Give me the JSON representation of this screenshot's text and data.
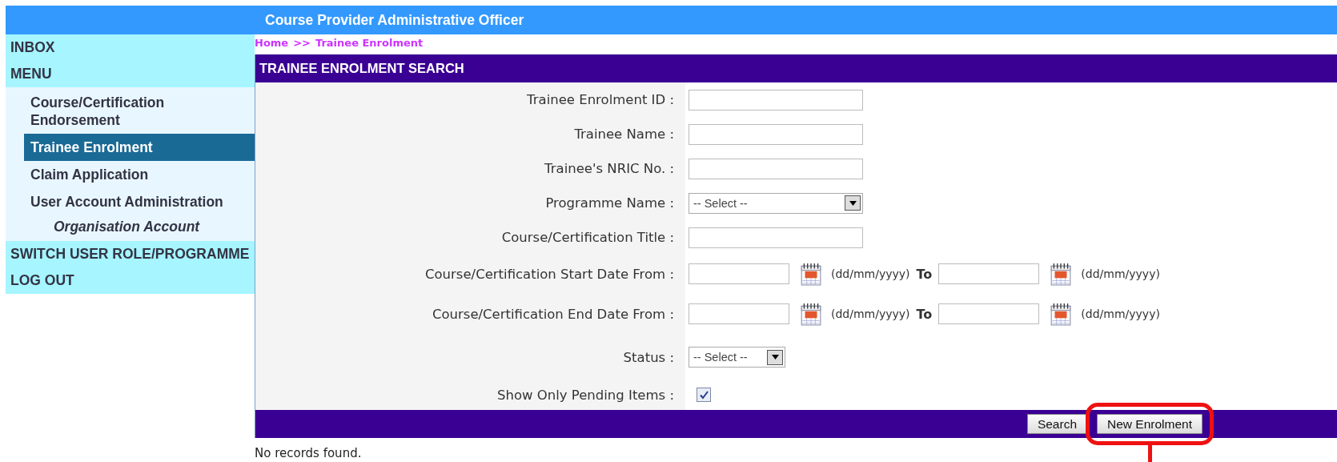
{
  "header": {
    "title": "Course Provider Administrative Officer"
  },
  "sidebar": {
    "items": [
      {
        "label": "INBOX",
        "selected": false
      },
      {
        "label": "MENU",
        "selected": false,
        "children": [
          {
            "label": "Course/Certification Endorsement",
            "selected": false
          },
          {
            "label": "Trainee Enrolment",
            "selected": true
          },
          {
            "label": "Claim Application",
            "selected": false
          },
          {
            "label": "User Account Administration",
            "selected": false,
            "children": [
              {
                "label": "Organisation Account",
                "selected": false
              }
            ]
          }
        ]
      },
      {
        "label": "SWITCH USER ROLE/PROGRAMME",
        "selected": false
      },
      {
        "label": "LOG OUT",
        "selected": false
      }
    ]
  },
  "breadcrumb": {
    "items": [
      "Home",
      "Trainee Enrolment"
    ],
    "separator": ">>"
  },
  "panel": {
    "title": "TRAINEE ENROLMENT SEARCH",
    "fields": [
      {
        "kind": "text",
        "label": "Trainee Enrolment ID :"
      },
      {
        "kind": "text",
        "label": "Trainee Name :"
      },
      {
        "kind": "text",
        "label": "Trainee's NRIC No. :"
      },
      {
        "kind": "select",
        "label": "Programme Name :",
        "value": "-- Select --"
      },
      {
        "kind": "text",
        "label": "Course/Certification Title :"
      },
      {
        "kind": "date_range",
        "label": "Course/Certification Start Date From :",
        "from_hint": "(dd/mm/yyyy)",
        "to_label": "To",
        "to_hint": "(dd/mm/yyyy)"
      },
      {
        "kind": "date_range",
        "label": "Course/Certification End Date From :",
        "from_hint": "(dd/mm/yyyy)",
        "to_label": "To",
        "to_hint": "(dd/mm/yyyy)"
      },
      {
        "kind": "shortselect",
        "label": "Status :",
        "value": "-- Select --"
      },
      {
        "kind": "checkbox",
        "label": "Show Only Pending Items :",
        "checked": true
      }
    ],
    "buttons": [
      {
        "label": "Search",
        "highlighted": false
      },
      {
        "label": "New Enrolment",
        "highlighted": true
      }
    ]
  },
  "message": "No records found."
}
